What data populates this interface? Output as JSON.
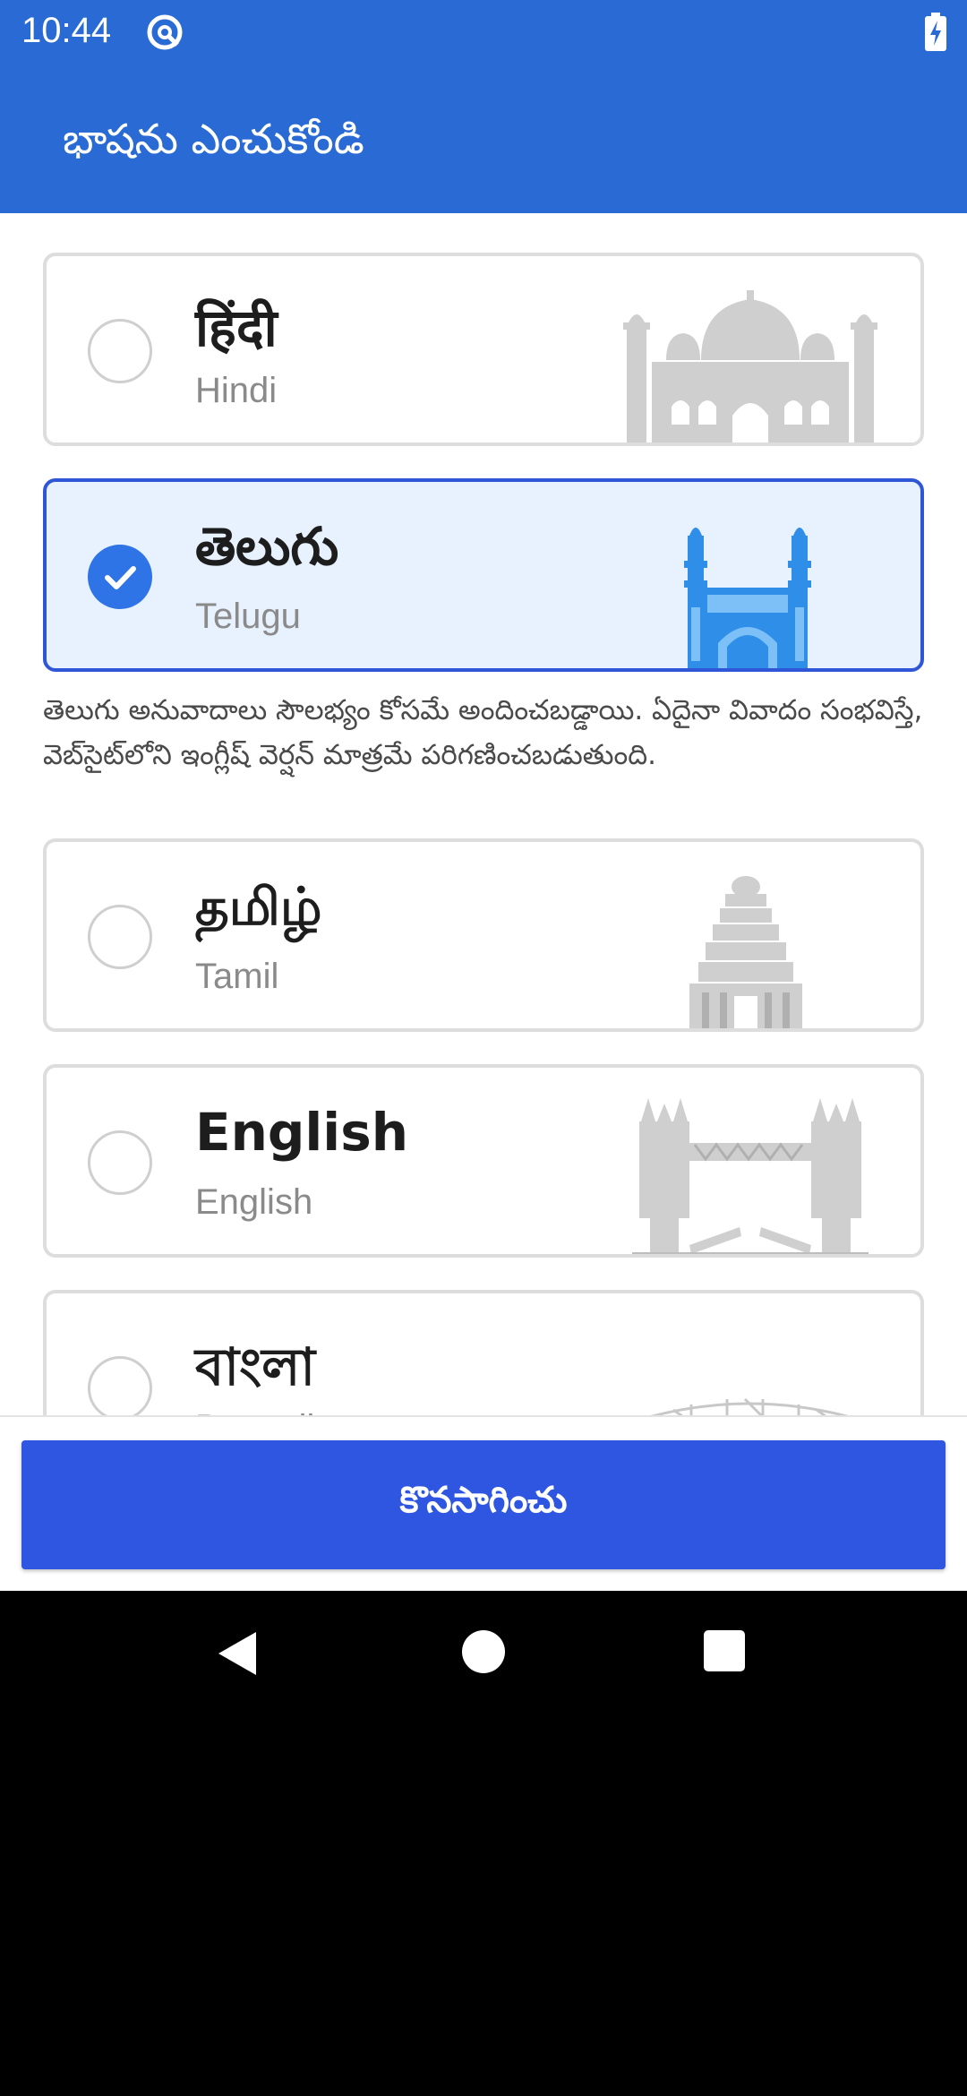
{
  "status_bar": {
    "time": "10:44"
  },
  "app_bar": {
    "title": "భాషను ఎంచుకోండి"
  },
  "languages": [
    {
      "native": "हिंदी",
      "english": "Hindi",
      "selected": false,
      "landmark": "taj-mahal"
    },
    {
      "native": "తెలుగు",
      "english": "Telugu",
      "selected": true,
      "landmark": "charminar"
    },
    {
      "native": "தமிழ்",
      "english": "Tamil",
      "selected": false,
      "landmark": "temple-gopuram"
    },
    {
      "native": "English",
      "english": "English",
      "selected": false,
      "landmark": "tower-bridge"
    },
    {
      "native": "বাংলা",
      "english": "Bengali",
      "selected": false,
      "landmark": "howrah-bridge"
    }
  ],
  "disclaimer": "తెలుగు అనువాదాలు సౌలభ్యం కోసమే అందించబడ్డాయి. ఏదైనా వివాదం సంభవిస్తే, వెబ్‌సైట్‌లోని ఇంగ్లీష్ వెర్షన్ మాత్రమే పరిగణించబడుతుంది.",
  "continue_button": {
    "label": "కొనసాగించు"
  },
  "colors": {
    "primary": "#2a6ad4",
    "button": "#2f56e0",
    "selected_bg": "#e8f1fe",
    "selected_border": "#2f56d6"
  }
}
